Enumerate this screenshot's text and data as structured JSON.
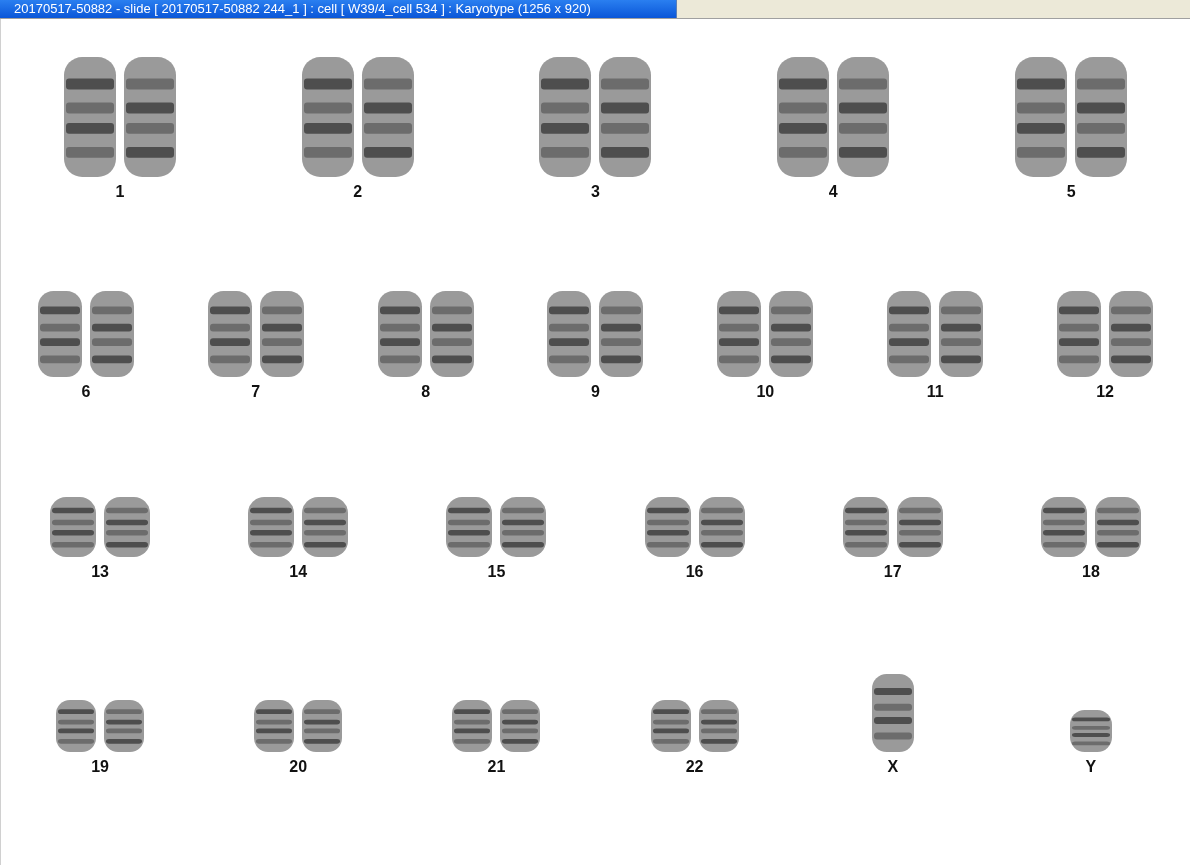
{
  "window": {
    "title": "20170517-50882 - slide [ 20170517-50882 244_1 ] : cell [ W39/4_cell 534 ] : Karyotype  (1256 x 920)"
  },
  "karyotype": {
    "rows": [
      [
        {
          "label": "1",
          "kind": "pair"
        },
        {
          "label": "2",
          "kind": "pair"
        },
        {
          "label": "3",
          "kind": "pair"
        },
        {
          "label": "4",
          "kind": "pair"
        },
        {
          "label": "5",
          "kind": "pair"
        }
      ],
      [
        {
          "label": "6",
          "kind": "pair"
        },
        {
          "label": "7",
          "kind": "pair"
        },
        {
          "label": "8",
          "kind": "pair"
        },
        {
          "label": "9",
          "kind": "pair"
        },
        {
          "label": "10",
          "kind": "pair"
        },
        {
          "label": "11",
          "kind": "pair"
        },
        {
          "label": "12",
          "kind": "pair"
        }
      ],
      [
        {
          "label": "13",
          "kind": "pair"
        },
        {
          "label": "14",
          "kind": "pair"
        },
        {
          "label": "15",
          "kind": "pair"
        },
        {
          "label": "16",
          "kind": "pair"
        },
        {
          "label": "17",
          "kind": "pair"
        },
        {
          "label": "18",
          "kind": "pair"
        }
      ],
      [
        {
          "label": "19",
          "kind": "pair"
        },
        {
          "label": "20",
          "kind": "pair"
        },
        {
          "label": "21",
          "kind": "pair"
        },
        {
          "label": "22",
          "kind": "pair"
        },
        {
          "label": "X",
          "kind": "single"
        },
        {
          "label": "Y",
          "kind": "single"
        }
      ]
    ]
  }
}
